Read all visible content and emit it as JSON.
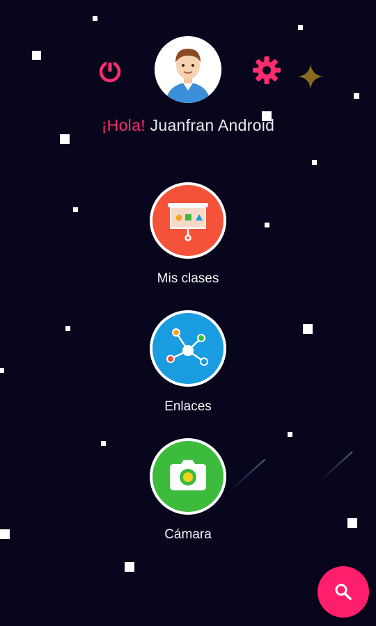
{
  "header": {
    "greeting_prefix": "¡Hola!",
    "user_name": "Juanfran Android",
    "power_icon": "power-icon",
    "settings_icon": "gear-icon",
    "sparkle_icon": "sparkle-icon",
    "avatar_icon": "avatar-icon"
  },
  "menu": {
    "items": [
      {
        "label": "Mis clases",
        "icon": "presentation-board-icon",
        "color": "#f4533a"
      },
      {
        "label": "Enlaces",
        "icon": "network-links-icon",
        "color": "#1a9ce0"
      },
      {
        "label": "Cámara",
        "icon": "camera-icon",
        "color": "#3dbb3c"
      }
    ]
  },
  "fab": {
    "icon": "search-icon",
    "color": "#ff1e6b"
  },
  "colors": {
    "background": "#07061c",
    "accent": "#ff2d6f",
    "sparkle": "#8a6a1f"
  }
}
